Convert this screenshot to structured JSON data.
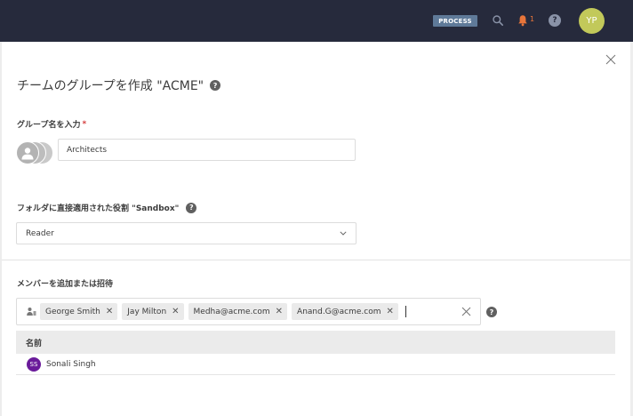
{
  "topbar": {
    "process_label": "PROCESS",
    "notification_count": "1",
    "help_icon_text": "?",
    "user_initials": "YP"
  },
  "dialog": {
    "title": "チームのグループを作成 \"ACME\"",
    "help_icon_text": "?"
  },
  "group_name": {
    "label": "グループ名を入力",
    "required_mark": "*",
    "value": "Architects"
  },
  "role": {
    "label": "フォルダに直接適用された役割 \"Sandbox\"",
    "help_icon_text": "?",
    "selected": "Reader"
  },
  "members": {
    "label": "メンバーを追加または招待",
    "chips": [
      "George Smith",
      "Jay Milton",
      "Medha@acme.com",
      "Anand.G@acme.com"
    ],
    "help_icon_text": "?"
  },
  "table": {
    "header_name": "名前",
    "rows": [
      {
        "initials": "SS",
        "name": "Sonali Singh"
      }
    ]
  },
  "colors": {
    "topbar_bg": "#262a3c",
    "process_badge": "#5f7a99",
    "bell": "#e8753a",
    "avatar_user": "#c2c95a",
    "row_avatar": "#6a1b9a",
    "required": "#d43b3b"
  }
}
